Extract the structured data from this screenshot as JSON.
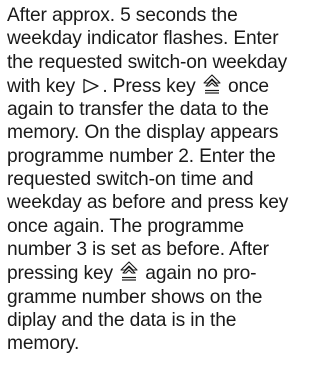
{
  "instruction_text": {
    "line_1": "After approx. 5 seconds the",
    "line_2": "weekday indicator flashes. Enter",
    "line_3": "the requested switch-on weekday",
    "line_4a": "with key",
    "line_4b": ". Press key",
    "line_4c": "once",
    "line_5": "again to transfer the data to the",
    "line_6": "memory. On the display appears",
    "line_7": "programme number 2. Enter the",
    "line_8": "requested switch-on time and",
    "line_9": "weekday as before and press key",
    "line_10": "once again. The programme",
    "line_11": "number 3 is set as before. After",
    "line_12a": "pressing key",
    "line_12b": "again no pro-",
    "line_13": "gramme number shows on the",
    "line_14": "diplay and the data is in the",
    "line_15": "memory."
  },
  "icons": {
    "key_right": "triangle-right-key-icon",
    "key_program": "program-transfer-key-icon"
  }
}
